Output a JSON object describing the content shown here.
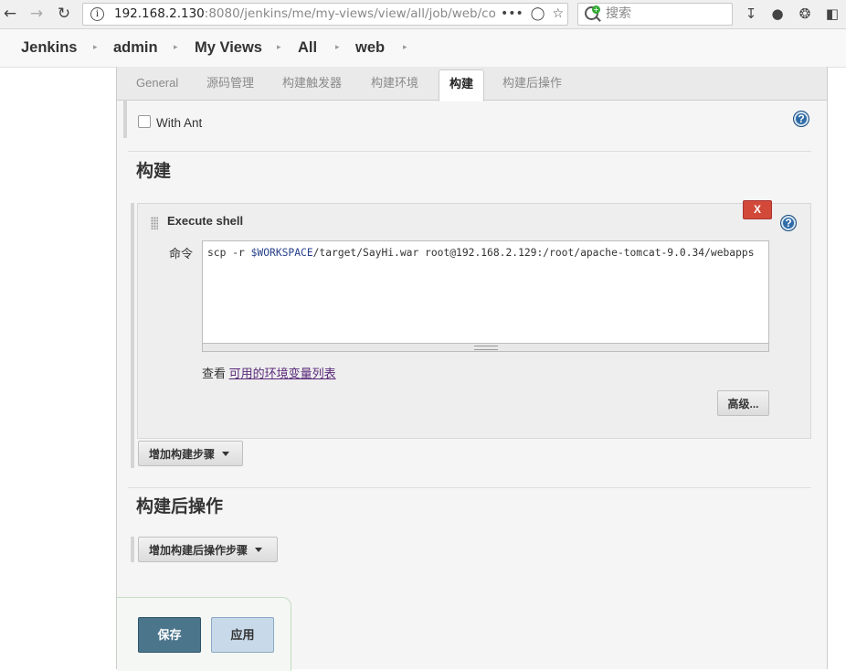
{
  "browser": {
    "url_host": "192.168.2.130",
    "url_rest": ":8080/jenkins/me/my-views/view/all/job/web/co",
    "search_placeholder": "搜索",
    "icons": [
      "back-icon",
      "forward-icon",
      "reload-icon",
      "info-icon",
      "more-icon",
      "pocket-icon",
      "bookmark-star-icon",
      "download-icon",
      "extension-icon",
      "extension-icon-2",
      "close-window-icon"
    ]
  },
  "breadcrumb": {
    "items": [
      "Jenkins",
      "admin",
      "My Views",
      "All",
      "web"
    ],
    "separator": "▸"
  },
  "tabs": {
    "items": [
      "General",
      "源码管理",
      "构建触发器",
      "构建环境",
      "构建",
      "构建后操作"
    ],
    "active": "构建"
  },
  "build_env": {
    "with_ant_label": "With Ant",
    "with_ant_checked": false
  },
  "build": {
    "section_title": "构建",
    "step": {
      "title": "Execute shell",
      "delete_label": "X",
      "command_label": "命令",
      "command_prefix": "scp -r ",
      "command_var": "$WORKSPACE",
      "command_suffix": "/target/SayHi.war root@192.168.2.129:/root/apache-tomcat-9.0.34/webapps",
      "env_prefix": "查看 ",
      "env_link": "可用的环境变量列表",
      "advanced_label": "高级..."
    },
    "add_step_label": "增加构建步骤"
  },
  "post_build": {
    "section_title": "构建后操作",
    "add_step_label": "增加构建后操作步骤"
  },
  "actions": {
    "save_label": "保存",
    "apply_label": "应用"
  },
  "help_label": "?"
}
